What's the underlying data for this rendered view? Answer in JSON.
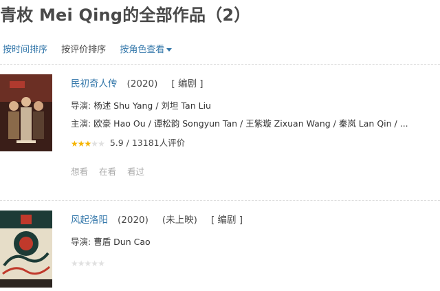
{
  "page": {
    "title": "青枚 Mei Qing的全部作品（2）"
  },
  "sort": {
    "by_time": "按时间排序",
    "by_rating": "按评价排序",
    "by_role": "按角色查看"
  },
  "works": [
    {
      "title": "民初奇人传",
      "year": "(2020)",
      "status": "",
      "role": "[ 编剧 ]",
      "director_label": "导演:",
      "directors": "杨述 Shu Yang / 刘坦 Tan Liu",
      "cast_label": "主演:",
      "cast": "欧豪 Hao Ou / 谭松韵 Songyun Tan / 王紫璇 Zixuan Wang / 秦岚 Lan Qin / ...",
      "rating_value": 5.9,
      "rating_stars": 3,
      "rating_text": "5.9 / 13181人评价",
      "actions": [
        "想看",
        "在看",
        "看过"
      ],
      "poster_colors": [
        "#5a2a22",
        "#c8a27a",
        "#2b1a14"
      ]
    },
    {
      "title": "风起洛阳",
      "year": "(2020)",
      "status": "(未上映)",
      "role": "[ 编剧 ]",
      "director_label": "导演:",
      "directors": "曹盾 Dun Cao",
      "rating_stars": 0,
      "poster_colors": [
        "#1d3b36",
        "#c0392b",
        "#e8e0cf"
      ]
    }
  ]
}
